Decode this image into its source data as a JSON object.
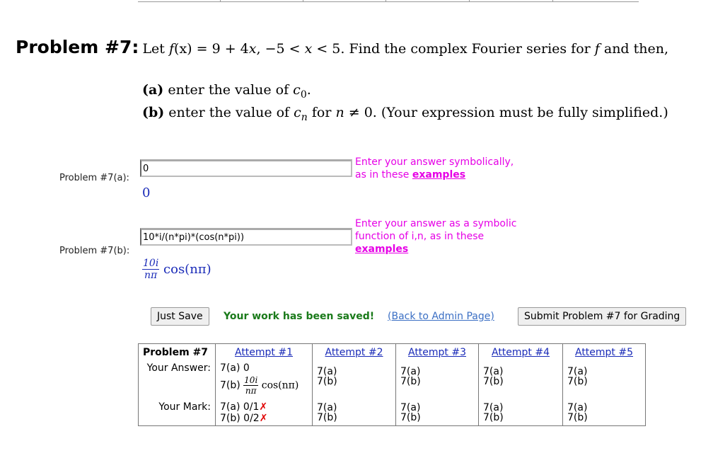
{
  "problem": {
    "label": "Problem #7:",
    "statement_prefix": "Let ",
    "f_name": "f",
    "f_arg": "(x)",
    "f_rhs": " = 9 + 4",
    "x_var": "x",
    "domain_text": ", −5 < ",
    "domain_x": "x",
    "domain_end": " < 5. Find the complex Fourier series for ",
    "f_ref": "f",
    "statement_suffix": " and then,",
    "part_a_label": "(a)",
    "part_a_text": " enter the value of ",
    "part_a_var": "c",
    "part_a_sub": "0",
    "part_a_end": ".",
    "part_b_label": "(b)",
    "part_b_text": " enter the value of ",
    "part_b_var": "c",
    "part_b_sub": "n",
    "part_b_mid": " for ",
    "part_b_n": "n",
    "part_b_neq": " ≠ 0. (Your expression must be fully simplified.)"
  },
  "answer_a": {
    "row_label": "Problem #7(a):",
    "value": "0",
    "preview": "0",
    "hint_line1": "Enter your answer symbolically,",
    "hint_line2": "as in these ",
    "hint_link": "examples"
  },
  "answer_b": {
    "row_label": "Problem #7(b):",
    "value": "10*i/(n*pi)*(cos(n*pi))",
    "preview_num": "10i",
    "preview_den": "nπ",
    "preview_rest": "cos(nπ)",
    "hint_line1": "Enter your answer as a symbolic",
    "hint_line2": "function of i,n, as in these",
    "hint_link": "examples"
  },
  "actions": {
    "save_label": "Just Save",
    "saved_msg": "Your work has been saved!",
    "back_link": "(Back to Admin Page)",
    "submit_label": "Submit Problem #7 for Grading"
  },
  "attempts": {
    "header": "Problem #7",
    "columns": [
      "Attempt #1",
      "Attempt #2",
      "Attempt #3",
      "Attempt #4",
      "Attempt #5"
    ],
    "your_answer_label": "Your Answer:",
    "your_mark_label": "Your Mark:",
    "a1_ans_a": "7(a) 0",
    "a1_ans_b_prefix": "7(b) ",
    "a1_frac_num": "10i",
    "a1_frac_den": "nπ",
    "a1_frac_rest": " cos(nπ)",
    "empty_a": "7(a)",
    "empty_b": "7(b)",
    "a1_mark_a": "7(a) 0/1",
    "a1_mark_b": "7(b) 0/2",
    "wrong_mark": "✗",
    "status_color_wrong": "#e00000"
  }
}
